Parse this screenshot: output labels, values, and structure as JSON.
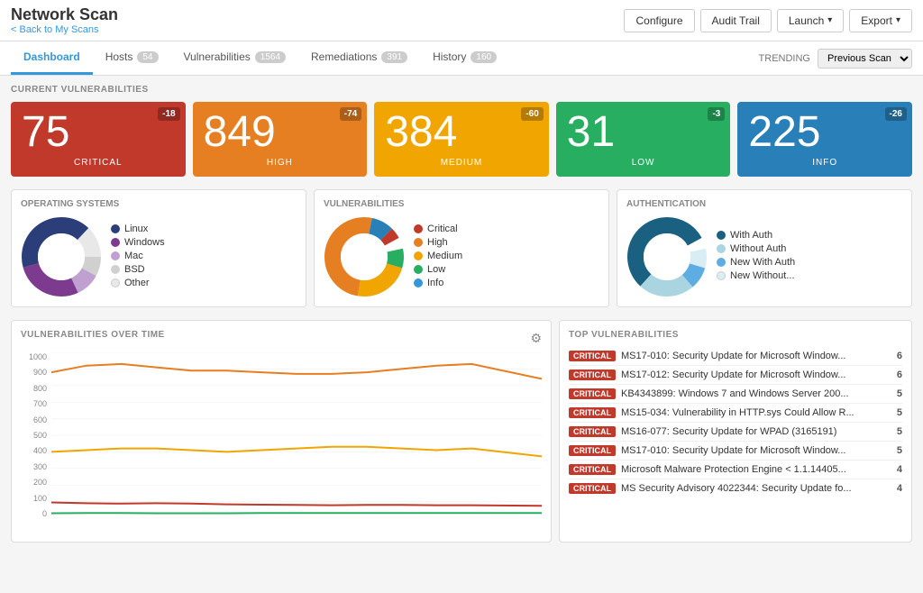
{
  "header": {
    "title": "Network Scan",
    "breadcrumb": "Scans",
    "back_link": "< Back to My Scans",
    "buttons": {
      "configure": "Configure",
      "audit_trail": "Audit Trail",
      "launch": "Launch",
      "export": "Export"
    }
  },
  "tabs": [
    {
      "id": "dashboard",
      "label": "Dashboard",
      "badge": null,
      "active": true
    },
    {
      "id": "hosts",
      "label": "Hosts",
      "badge": "54",
      "active": false
    },
    {
      "id": "vulnerabilities",
      "label": "Vulnerabilities",
      "badge": "1564",
      "active": false
    },
    {
      "id": "remediations",
      "label": "Remediations",
      "badge": "391",
      "active": false
    },
    {
      "id": "history",
      "label": "History",
      "badge": "160",
      "active": false
    }
  ],
  "trending": {
    "label": "TRENDING",
    "value": "Previous Scan"
  },
  "current_vulnerabilities": {
    "label": "CURRENT VULNERABILITIES",
    "cards": [
      {
        "id": "critical",
        "num": "75",
        "label": "CRITICAL",
        "badge": "-18",
        "class": "card-critical"
      },
      {
        "id": "high",
        "num": "849",
        "label": "HIGH",
        "badge": "-74",
        "class": "card-high"
      },
      {
        "id": "medium",
        "num": "384",
        "label": "MEDIUM",
        "badge": "-60",
        "class": "card-medium"
      },
      {
        "id": "low",
        "num": "31",
        "label": "LOW",
        "badge": "-3",
        "class": "card-low"
      },
      {
        "id": "info",
        "num": "225",
        "label": "INFO",
        "badge": "-26",
        "class": "card-info"
      }
    ]
  },
  "os_chart": {
    "title": "OPERATING SYSTEMS",
    "legend": [
      {
        "label": "Linux",
        "color": "#2c3e7a"
      },
      {
        "label": "Windows",
        "color": "#7d3b8f"
      },
      {
        "label": "Mac",
        "color": "#c0a0d0"
      },
      {
        "label": "BSD",
        "color": "#d0d0d0"
      },
      {
        "label": "Other",
        "color": "#e8e8e8"
      }
    ],
    "segments": [
      {
        "color": "#2c3e7a",
        "pct": 45
      },
      {
        "color": "#7d3b8f",
        "pct": 30
      },
      {
        "color": "#c0a0d0",
        "pct": 10
      },
      {
        "color": "#d0d0d0",
        "pct": 8
      },
      {
        "color": "#e8e8e8",
        "pct": 7
      }
    ]
  },
  "vuln_chart": {
    "title": "VULNERABILITIES",
    "legend": [
      {
        "label": "Critical",
        "color": "#c0392b"
      },
      {
        "label": "High",
        "color": "#e67e22"
      },
      {
        "label": "Medium",
        "color": "#f0a500"
      },
      {
        "label": "Low",
        "color": "#27ae60"
      },
      {
        "label": "Info",
        "color": "#3498db"
      }
    ],
    "segments": [
      {
        "color": "#c0392b",
        "pct": 5
      },
      {
        "color": "#2980b9",
        "pct": 10
      },
      {
        "color": "#e67e22",
        "pct": 55
      },
      {
        "color": "#f0a500",
        "pct": 25
      },
      {
        "color": "#27ae60",
        "pct": 5
      }
    ]
  },
  "auth_chart": {
    "title": "AUTHENTICATION",
    "legend": [
      {
        "label": "With Auth",
        "color": "#1a5276"
      },
      {
        "label": "Without Auth",
        "color": "#d0e8f0"
      },
      {
        "label": "New With Auth",
        "color": "#5dade2"
      },
      {
        "label": "New Without...",
        "color": "#e8f4f8"
      }
    ],
    "segments": [
      {
        "color": "#1a6080",
        "pct": 60
      },
      {
        "color": "#aad4e0",
        "pct": 25
      },
      {
        "color": "#5dade2",
        "pct": 10
      },
      {
        "color": "#d8eef4",
        "pct": 5
      }
    ]
  },
  "vuln_over_time": {
    "title": "VULNERABILITIES OVER TIME",
    "y_axis": [
      "1000",
      "900",
      "800",
      "700",
      "600",
      "500",
      "400",
      "300",
      "200",
      "100",
      "0"
    ],
    "series": [
      {
        "id": "high",
        "color": "#e67e22",
        "points": [
          880,
          920,
          930,
          910,
          890,
          890,
          880,
          870,
          870,
          880,
          900,
          920,
          930,
          840
        ],
        "label": "High"
      },
      {
        "id": "medium",
        "color": "#f0a500",
        "points": [
          400,
          410,
          420,
          420,
          410,
          400,
          410,
          420,
          430,
          430,
          420,
          410,
          420,
          385
        ],
        "label": "Medium"
      },
      {
        "id": "critical",
        "color": "#c0392b",
        "points": [
          95,
          90,
          88,
          90,
          88,
          85,
          83,
          82,
          80,
          82,
          82,
          80,
          80,
          75
        ],
        "label": "Critical"
      },
      {
        "id": "low",
        "color": "#27ae60",
        "points": [
          30,
          31,
          31,
          30,
          30,
          30,
          31,
          31,
          31,
          31,
          31,
          31,
          31,
          31
        ],
        "label": "Low"
      }
    ],
    "x_range": [
      0,
      1000
    ]
  },
  "top_vulnerabilities": {
    "title": "TOP VULNERABILITIES",
    "items": [
      {
        "severity": "CRITICAL",
        "name": "MS17-010: Security Update for Microsoft Window...",
        "count": "6"
      },
      {
        "severity": "CRITICAL",
        "name": "MS17-012: Security Update for Microsoft Window...",
        "count": "6"
      },
      {
        "severity": "CRITICAL",
        "name": "KB4343899: Windows 7 and Windows Server 200...",
        "count": "5"
      },
      {
        "severity": "CRITICAL",
        "name": "MS15-034: Vulnerability in HTTP.sys Could Allow R...",
        "count": "5"
      },
      {
        "severity": "CRITICAL",
        "name": "MS16-077: Security Update for WPAD (3165191)",
        "count": "5"
      },
      {
        "severity": "CRITICAL",
        "name": "MS17-010: Security Update for Microsoft Window...",
        "count": "5"
      },
      {
        "severity": "CRITICAL",
        "name": "Microsoft Malware Protection Engine < 1.1.14405...",
        "count": "4"
      },
      {
        "severity": "CRITICAL",
        "name": "MS Security Advisory 4022344: Security Update fo...",
        "count": "4"
      }
    ]
  }
}
